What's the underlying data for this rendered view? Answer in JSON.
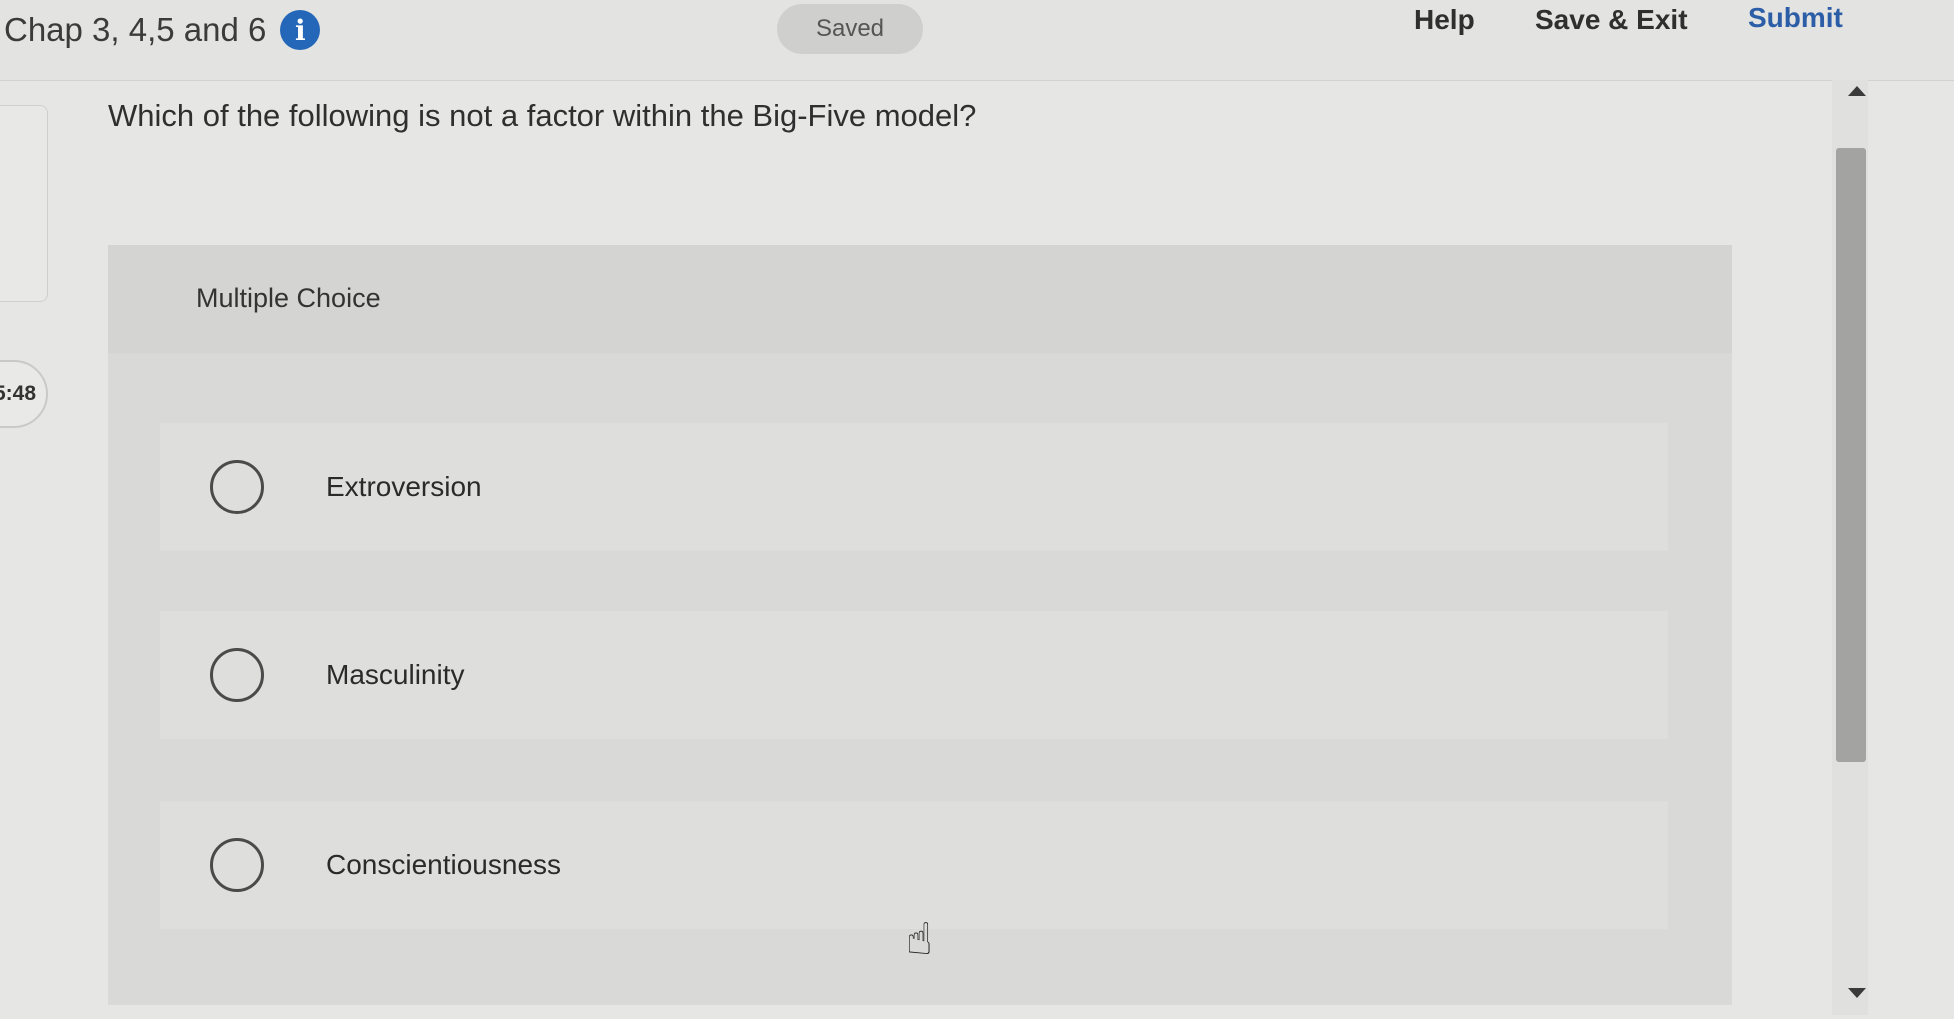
{
  "header": {
    "title": "Chap 3, 4,5 and 6",
    "info_icon": "info-icon",
    "saved_label": "Saved",
    "help_label": "Help",
    "save_exit_label": "Save & Exit",
    "submit_label": "Submit",
    "submit_color": "#2c5ea8"
  },
  "timer": {
    "text": "5:48"
  },
  "question": {
    "text": "Which of the following is not a factor within the Big-Five model?",
    "type_label": "Multiple Choice",
    "options": [
      {
        "label": "Extroversion",
        "selected": false
      },
      {
        "label": "Masculinity",
        "selected": false
      },
      {
        "label": "Conscientiousness",
        "selected": false
      }
    ]
  },
  "scrollbar": {
    "up_icon": "triangle-up-icon",
    "down_icon": "triangle-down-icon"
  },
  "cursor": {
    "icon": "hand-pointer-icon"
  }
}
